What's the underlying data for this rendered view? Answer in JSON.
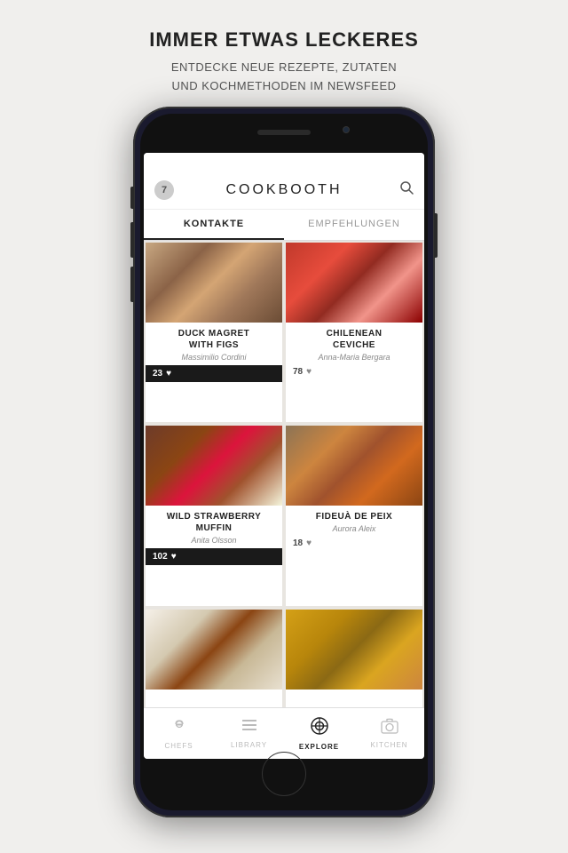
{
  "header": {
    "title": "IMMER ETWAS LECKERES",
    "subtitle": "ENTDECKE NEUE REZEPTE, ZUTATEN\nUND KOCHMETHODEN IM NEWSFEED"
  },
  "app": {
    "name": "COOKBOOTH",
    "badge": "7",
    "tabs": [
      {
        "id": "kontakte",
        "label": "KONTAKTE",
        "active": true
      },
      {
        "id": "empfehlungen",
        "label": "EMPFEHLUNGEN",
        "active": false
      }
    ],
    "recipes": [
      {
        "id": 1,
        "title": "DUCK MAGRET\nWITH FIGS",
        "author": "Massimilio Cordini",
        "likes": "23",
        "has_dark_bar": true,
        "img_class": "food-duck"
      },
      {
        "id": 2,
        "title": "CHILENEAN\nCEVICHE",
        "author": "Anna-Maria Bergara",
        "likes": "78",
        "has_dark_bar": false,
        "img_class": "food-ceviche"
      },
      {
        "id": 3,
        "title": "WILD STRAWBERRY\nMUFFIN",
        "author": "Anita Olsson",
        "likes": "102",
        "has_dark_bar": true,
        "img_class": "food-muffin"
      },
      {
        "id": 4,
        "title": "FIDEUÀ DE PEIX",
        "author": "Aurora Aleix",
        "likes": "18",
        "has_dark_bar": false,
        "img_class": "food-fideu"
      },
      {
        "id": 5,
        "title": "",
        "author": "",
        "likes": "",
        "has_dark_bar": false,
        "img_class": "food-plate1"
      },
      {
        "id": 6,
        "title": "",
        "author": "",
        "likes": "",
        "has_dark_bar": false,
        "img_class": "food-noodles"
      }
    ],
    "nav": [
      {
        "id": "chefs",
        "label": "CHEFS",
        "icon": "👨‍🍳",
        "active": false
      },
      {
        "id": "library",
        "label": "LIBRARY",
        "icon": "☰",
        "active": false
      },
      {
        "id": "explore",
        "label": "EXPLORE",
        "icon": "◎",
        "active": true
      },
      {
        "id": "kitchen",
        "label": "KITCHEN",
        "icon": "📷",
        "active": false
      }
    ]
  }
}
